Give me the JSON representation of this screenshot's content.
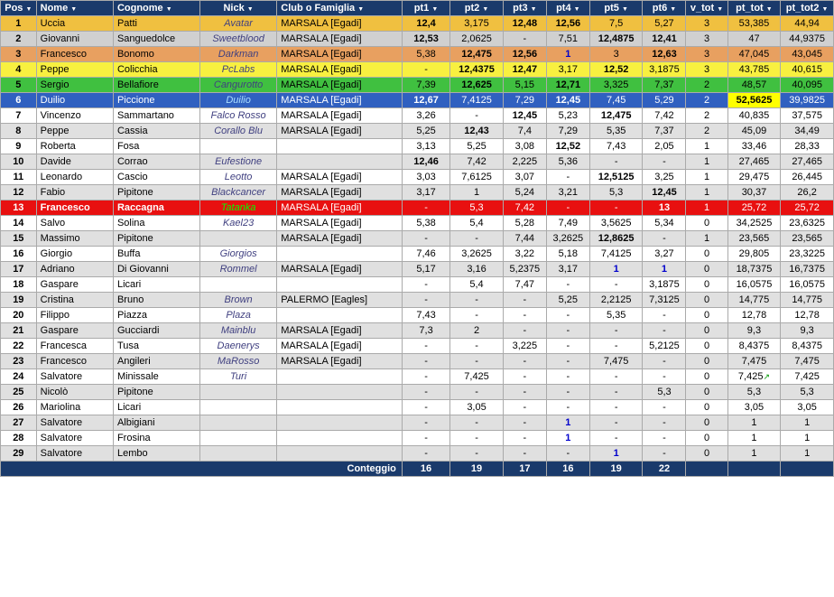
{
  "table": {
    "headers": [
      "Pos",
      "Nome",
      "Cognome",
      "Nick",
      "Club o Famiglia",
      "pt1",
      "pt2",
      "pt3",
      "pt4",
      "pt5",
      "pt6",
      "v_tot",
      "pt_tot",
      "pt_tot2"
    ],
    "footer_label": "Conteggio",
    "footer_values": [
      "16",
      "19",
      "17",
      "16",
      "19",
      "22"
    ],
    "rows": [
      {
        "pos": "1",
        "nome": "Uccia",
        "cognome": "Patti",
        "nick": "Avatar",
        "club": "MARSALA [Egadi]",
        "pt1": "12,4",
        "pt2": "3,175",
        "pt3": "12,48",
        "pt4": "12,56",
        "pt5": "7,5",
        "pt6": "5,27",
        "vtot": "3",
        "pttot": "53,385",
        "pttot2": "44,94",
        "style": "gold",
        "nick_style": "normal"
      },
      {
        "pos": "2",
        "nome": "Giovanni",
        "cognome": "Sanguedolce",
        "nick": "Sweetblood",
        "club": "MARSALA [Egadi]",
        "pt1": "12,53",
        "pt2": "2,0625",
        "pt3": "-",
        "pt4": "7,51",
        "pt5": "12,4875",
        "pt6": "12,41",
        "vtot": "3",
        "pttot": "47",
        "pttot2": "44,9375",
        "style": "silver",
        "nick_style": "normal"
      },
      {
        "pos": "3",
        "nome": "Francesco",
        "cognome": "Bonomo",
        "nick": "Darkman",
        "club": "MARSALA [Egadi]",
        "pt1": "5,38",
        "pt2": "12,475",
        "pt3": "12,56",
        "pt4": "1",
        "pt5": "3",
        "pt6": "12,63",
        "vtot": "3",
        "pttot": "47,045",
        "pttot2": "43,045",
        "style": "bronze",
        "nick_style": "normal"
      },
      {
        "pos": "4",
        "nome": "Peppe",
        "cognome": "Colicchia",
        "nick": "PcLabs",
        "club": "MARSALA [Egadi]",
        "pt1": "-",
        "pt2": "12,4375",
        "pt3": "12,47",
        "pt4": "3,17",
        "pt5": "12,52",
        "pt6": "3,1875",
        "vtot": "3",
        "pttot": "43,785",
        "pttot2": "40,615",
        "style": "yellow",
        "nick_style": "normal"
      },
      {
        "pos": "5",
        "nome": "Sergio",
        "cognome": "Bellafiore",
        "nick": "Cangurotto",
        "club": "MARSALA [Egadi]",
        "pt1": "7,39",
        "pt2": "12,625",
        "pt3": "5,15",
        "pt4": "12,71",
        "pt5": "3,325",
        "pt6": "7,37",
        "vtot": "2",
        "pttot": "48,57",
        "pttot2": "40,095",
        "style": "green",
        "nick_style": "normal"
      },
      {
        "pos": "6",
        "nome": "Duilio",
        "cognome": "Piccione",
        "nick": "Duilio",
        "club": "MARSALA [Egadi]",
        "pt1": "12,67",
        "pt2": "7,4125",
        "pt3": "7,29",
        "pt4": "12,45",
        "pt5": "7,45",
        "pt6": "5,29",
        "vtot": "2",
        "pttot": "52,5625",
        "pttot2": "39,9825",
        "style": "blue",
        "nick_style": "normal"
      },
      {
        "pos": "7",
        "nome": "Vincenzo",
        "cognome": "Sammartano",
        "nick": "Falco Rosso",
        "club": "MARSALA [Egadi]",
        "pt1": "3,26",
        "pt2": "-",
        "pt3": "12,45",
        "pt4": "5,23",
        "pt5": "12,475",
        "pt6": "7,42",
        "vtot": "2",
        "pttot": "40,835",
        "pttot2": "37,575",
        "style": "even",
        "nick_style": "normal"
      },
      {
        "pos": "8",
        "nome": "Peppe",
        "cognome": "Cassia",
        "nick": "Corallo Blu",
        "club": "MARSALA [Egadi]",
        "pt1": "5,25",
        "pt2": "12,43",
        "pt3": "7,4",
        "pt4": "7,29",
        "pt5": "5,35",
        "pt6": "7,37",
        "vtot": "2",
        "pttot": "45,09",
        "pttot2": "34,49",
        "style": "odd",
        "nick_style": "normal"
      },
      {
        "pos": "9",
        "nome": "Roberta",
        "cognome": "Fosa",
        "nick": "",
        "club": "",
        "pt1": "3,13",
        "pt2": "5,25",
        "pt3": "3,08",
        "pt4": "12,52",
        "pt5": "7,43",
        "pt6": "2,05",
        "vtot": "1",
        "pttot": "33,46",
        "pttot2": "28,33",
        "style": "even",
        "nick_style": "normal"
      },
      {
        "pos": "10",
        "nome": "Davide",
        "cognome": "Corrao",
        "nick": "Eufestione",
        "club": "",
        "pt1": "12,46",
        "pt2": "7,42",
        "pt3": "2,225",
        "pt4": "5,36",
        "pt5": "-",
        "pt6": "-",
        "vtot": "1",
        "pttot": "27,465",
        "pttot2": "27,465",
        "style": "odd",
        "nick_style": "normal"
      },
      {
        "pos": "11",
        "nome": "Leonardo",
        "cognome": "Cascio",
        "nick": "Leotto",
        "club": "MARSALA [Egadi]",
        "pt1": "3,03",
        "pt2": "7,6125",
        "pt3": "3,07",
        "pt4": "-",
        "pt5": "12,5125",
        "pt6": "3,25",
        "vtot": "1",
        "pttot": "29,475",
        "pttot2": "26,445",
        "style": "even",
        "nick_style": "normal"
      },
      {
        "pos": "12",
        "nome": "Fabio",
        "cognome": "Pipitone",
        "nick": "Blackcancer",
        "club": "MARSALA [Egadi]",
        "pt1": "3,17",
        "pt2": "1",
        "pt3": "5,24",
        "pt4": "3,21",
        "pt5": "5,3",
        "pt6": "12,45",
        "vtot": "1",
        "pttot": "30,37",
        "pttot2": "26,2",
        "style": "odd",
        "nick_style": "normal"
      },
      {
        "pos": "13",
        "nome": "Francesco",
        "cognome": "Raccagna",
        "nick": "Tatanka",
        "club": "MARSALA [Egadi]",
        "pt1": "-",
        "pt2": "5,3",
        "pt3": "7,42",
        "pt4": "-",
        "pt5": "-",
        "pt6": "13",
        "vtot": "1",
        "pttot": "25,72",
        "pttot2": "25,72",
        "style": "red",
        "nick_style": "green",
        "pt6_red": true
      },
      {
        "pos": "14",
        "nome": "Salvo",
        "cognome": "Solina",
        "nick": "Kael23",
        "club": "MARSALA [Egadi]",
        "pt1": "5,38",
        "pt2": "5,4",
        "pt3": "5,28",
        "pt4": "7,49",
        "pt5": "3,5625",
        "pt6": "5,34",
        "vtot": "0",
        "pttot": "34,2525",
        "pttot2": "23,6325",
        "style": "even",
        "nick_style": "normal"
      },
      {
        "pos": "15",
        "nome": "Massimo",
        "cognome": "Pipitone",
        "nick": "",
        "club": "MARSALA [Egadi]",
        "pt1": "-",
        "pt2": "-",
        "pt3": "7,44",
        "pt4": "3,2625",
        "pt5": "12,8625",
        "pt6": "-",
        "vtot": "1",
        "pttot": "23,565",
        "pttot2": "23,565",
        "style": "odd",
        "nick_style": "normal"
      },
      {
        "pos": "16",
        "nome": "Giorgio",
        "cognome": "Buffa",
        "nick": "Giorgios",
        "club": "",
        "pt1": "7,46",
        "pt2": "3,2625",
        "pt3": "3,22",
        "pt4": "5,18",
        "pt5": "7,4125",
        "pt6": "3,27",
        "vtot": "0",
        "pttot": "29,805",
        "pttot2": "23,3225",
        "style": "even",
        "nick_style": "normal"
      },
      {
        "pos": "17",
        "nome": "Adriano",
        "cognome": "Di Giovanni",
        "nick": "Rommel",
        "club": "MARSALA [Egadi]",
        "pt1": "5,17",
        "pt2": "3,16",
        "pt3": "5,2375",
        "pt4": "3,17",
        "pt5": "1",
        "pt6": "1",
        "vtot": "0",
        "pttot": "18,7375",
        "pttot2": "16,7375",
        "style": "odd",
        "nick_style": "normal"
      },
      {
        "pos": "18",
        "nome": "Gaspare",
        "cognome": "Licari",
        "nick": "",
        "club": "",
        "pt1": "-",
        "pt2": "5,4",
        "pt3": "7,47",
        "pt4": "-",
        "pt5": "-",
        "pt6": "3,1875",
        "vtot": "0",
        "pttot": "16,0575",
        "pttot2": "16,0575",
        "style": "even",
        "nick_style": "normal"
      },
      {
        "pos": "19",
        "nome": "Cristina",
        "cognome": "Bruno",
        "nick": "Brown",
        "club": "PALERMO [Eagles]",
        "pt1": "-",
        "pt2": "-",
        "pt3": "-",
        "pt4": "5,25",
        "pt5": "2,2125",
        "pt6": "7,3125",
        "vtot": "0",
        "pttot": "14,775",
        "pttot2": "14,775",
        "style": "odd",
        "nick_style": "normal"
      },
      {
        "pos": "20",
        "nome": "Filippo",
        "cognome": "Piazza",
        "nick": "Plaza",
        "club": "",
        "pt1": "7,43",
        "pt2": "-",
        "pt3": "-",
        "pt4": "-",
        "pt5": "5,35",
        "pt6": "-",
        "vtot": "0",
        "pttot": "12,78",
        "pttot2": "12,78",
        "style": "even",
        "nick_style": "normal"
      },
      {
        "pos": "21",
        "nome": "Gaspare",
        "cognome": "Gucciardi",
        "nick": "Mainblu",
        "club": "MARSALA [Egadi]",
        "pt1": "7,3",
        "pt2": "2",
        "pt3": "-",
        "pt4": "-",
        "pt5": "-",
        "pt6": "-",
        "vtot": "0",
        "pttot": "9,3",
        "pttot2": "9,3",
        "style": "odd",
        "nick_style": "normal"
      },
      {
        "pos": "22",
        "nome": "Francesca",
        "cognome": "Tusa",
        "nick": "Daenerys",
        "club": "MARSALA [Egadi]",
        "pt1": "-",
        "pt2": "-",
        "pt3": "3,225",
        "pt4": "-",
        "pt5": "-",
        "pt6": "5,2125",
        "vtot": "0",
        "pttot": "8,4375",
        "pttot2": "8,4375",
        "style": "even",
        "nick_style": "normal"
      },
      {
        "pos": "23",
        "nome": "Francesco",
        "cognome": "Angileri",
        "nick": "MaRosso",
        "club": "MARSALA [Egadi]",
        "pt1": "-",
        "pt2": "-",
        "pt3": "-",
        "pt4": "-",
        "pt5": "7,475",
        "pt6": "-",
        "vtot": "0",
        "pttot": "7,475",
        "pttot2": "7,475",
        "style": "odd",
        "nick_style": "normal"
      },
      {
        "pos": "24",
        "nome": "Salvatore",
        "cognome": "Minissale",
        "nick": "Turi",
        "club": "",
        "pt1": "-",
        "pt2": "7,425",
        "pt3": "-",
        "pt4": "-",
        "pt5": "-",
        "pt6": "-",
        "vtot": "0",
        "pttot": "7,425",
        "pttot2": "7,425",
        "style": "even",
        "nick_style": "normal"
      },
      {
        "pos": "25",
        "nome": "Nicolò",
        "cognome": "Pipitone",
        "nick": "",
        "club": "",
        "pt1": "-",
        "pt2": "-",
        "pt3": "-",
        "pt4": "-",
        "pt5": "-",
        "pt6": "5,3",
        "vtot": "0",
        "pttot": "5,3",
        "pttot2": "5,3",
        "style": "odd",
        "nick_style": "normal"
      },
      {
        "pos": "26",
        "nome": "Mariolina",
        "cognome": "Licari",
        "nick": "",
        "club": "",
        "pt1": "-",
        "pt2": "3,05",
        "pt3": "-",
        "pt4": "-",
        "pt5": "-",
        "pt6": "-",
        "vtot": "0",
        "pttot": "3,05",
        "pttot2": "3,05",
        "style": "even",
        "nick_style": "normal"
      },
      {
        "pos": "27",
        "nome": "Salvatore",
        "cognome": "Albigiani",
        "nick": "",
        "club": "",
        "pt1": "-",
        "pt2": "-",
        "pt3": "-",
        "pt4": "1",
        "pt5": "-",
        "pt6": "-",
        "vtot": "0",
        "pttot": "1",
        "pttot2": "1",
        "style": "odd",
        "nick_style": "normal"
      },
      {
        "pos": "28",
        "nome": "Salvatore",
        "cognome": "Frosina",
        "nick": "",
        "club": "",
        "pt1": "-",
        "pt2": "-",
        "pt3": "-",
        "pt4": "1",
        "pt5": "-",
        "pt6": "-",
        "vtot": "0",
        "pttot": "1",
        "pttot2": "1",
        "style": "even",
        "nick_style": "normal"
      },
      {
        "pos": "29",
        "nome": "Salvatore",
        "cognome": "Lembo",
        "nick": "",
        "club": "",
        "pt1": "-",
        "pt2": "-",
        "pt3": "-",
        "pt4": "-",
        "pt5": "1",
        "pt6": "-",
        "vtot": "0",
        "pttot": "1",
        "pttot2": "1",
        "style": "odd",
        "nick_style": "normal"
      }
    ]
  }
}
